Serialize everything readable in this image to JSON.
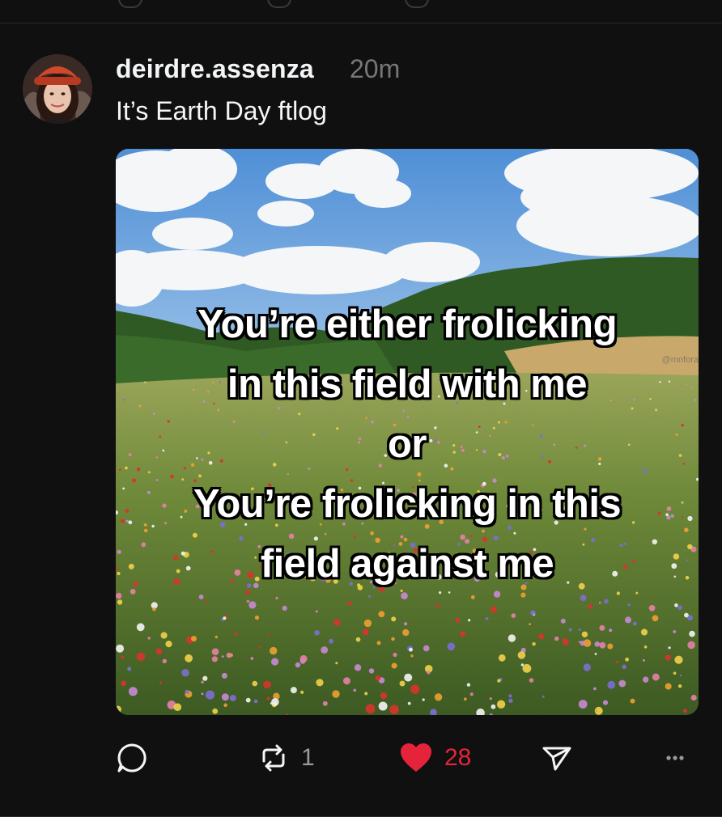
{
  "post": {
    "username": "deirdre.assenza",
    "timestamp": "20m",
    "text": "It’s Earth Day ftlog",
    "avatar_icon": "profile-photo",
    "media": {
      "meme_lines": [
        "You’re either frolicking",
        "in this field with me",
        "or",
        "You’re frolicking in this",
        "field against me"
      ],
      "watermark": "@mnfora"
    },
    "actions": {
      "reply_icon": "speech-bubble-icon",
      "repost_icon": "repost-icon",
      "repost_count": "1",
      "like_icon": "heart-icon",
      "like_count": "28",
      "share_icon": "send-icon",
      "more_icon": "ellipsis-icon"
    }
  },
  "colors": {
    "background": "#101010",
    "like_active": "#e5243b",
    "muted": "#777777"
  }
}
